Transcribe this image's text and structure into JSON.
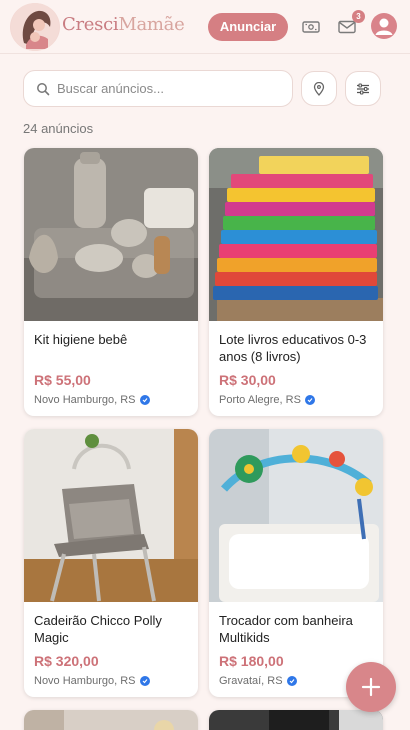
{
  "header": {
    "brand_part1": "Cresci",
    "brand_part2": "Mamãe",
    "announce_label": "Anunciar",
    "messages_badge": "3"
  },
  "search": {
    "placeholder": "Buscar anúncios..."
  },
  "results_count": "24 anúncios",
  "listings": [
    {
      "title": "Kit higiene bebê",
      "price": "R$ 55,00",
      "location": "Novo Hamburgo, RS",
      "verified": true
    },
    {
      "title": "Lote livros educativos 0-3 anos (8 livros)",
      "price": "R$ 30,00",
      "location": "Porto Alegre, RS",
      "verified": true
    },
    {
      "title": "Cadeirão Chicco Polly Magic",
      "price": "R$ 320,00",
      "location": "Novo Hamburgo, RS",
      "verified": true
    },
    {
      "title": "Trocador com banheira Multikids",
      "price": "R$ 180,00",
      "location": "Gravataí, RS",
      "verified": true
    }
  ],
  "colors": {
    "accent": "#d57f83",
    "background": "#fcf3f1",
    "price": "#cd7278",
    "verified": "#2f77e8"
  }
}
